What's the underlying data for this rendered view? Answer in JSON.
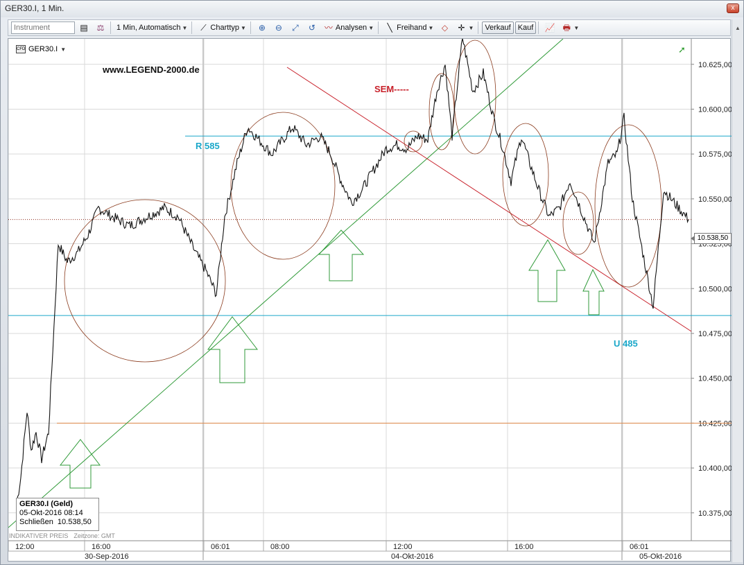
{
  "window": {
    "title": "GER30.I, 1 Min.",
    "close_label": "x"
  },
  "toolbar": {
    "instrument_placeholder": "Instrument",
    "interval_label": "1 Min,",
    "interval_mode": "Automatisch",
    "charttype_label": "Charttyp",
    "analysen_label": "Analysen",
    "freihand_label": "Freihand",
    "verkauf_label": "Verkauf",
    "kauf_label": "Kauf"
  },
  "chart_header": {
    "instrument": "GER30.I",
    "cfd_badge": "CFD"
  },
  "annotations": {
    "website": "www.LEGEND-2000.de",
    "sem": "SEM-----",
    "r585": "R 585",
    "u485": "U 485"
  },
  "tooltip": {
    "title": "GER30.I (Geld)",
    "datetime": "05-Okt-2016 08:14",
    "close_label": "Schließen",
    "close_value": "10.538,50"
  },
  "footer": {
    "indicative": "INDIKATIVER PREIS",
    "timezone": "Zeitzone: GMT"
  },
  "price_tag": "10.538,50",
  "colors": {
    "price_line": "#111111",
    "resistance": "#1aa7c9",
    "support_orange": "#e08a4a",
    "trend_green": "#2f9a38",
    "trend_red": "#c8202a",
    "circles": "#8a3a1c",
    "arrows": "#2f9a38"
  },
  "chart_data": {
    "type": "line",
    "title": "",
    "xlabel": "",
    "ylabel": "",
    "ylim": [
      10365,
      10650
    ],
    "y_ticks": [
      "10.375,00",
      "10.400,00",
      "10.425,00",
      "10.450,00",
      "10.475,00",
      "10.500,00",
      "10.525,00",
      "10.550,00",
      "10.575,00",
      "10.600,00",
      "10.625,00"
    ],
    "x_ticks": [
      "12:00",
      "16:00",
      "06:01",
      "08:00",
      "12:00",
      "16:00",
      "06:01"
    ],
    "date_labels": [
      "30-Sep-2016",
      "04-Okt-2016",
      "05-Okt-2016"
    ],
    "last_price": 10538.5,
    "horizontal_levels": [
      {
        "name": "R 585",
        "value": 10585
      },
      {
        "name": "U 485",
        "value": 10485
      },
      {
        "name": "",
        "value": 10425
      },
      {
        "name": "",
        "value": 10538.5
      }
    ],
    "series": [
      {
        "x": [
          "30-Sep 10:45",
          "30-Sep 11:00",
          "30-Sep 11:15",
          "30-Sep 11:30",
          "30-Sep 11:45",
          "30-Sep 12:00",
          "30-Sep 12:30",
          "30-Sep 13:00",
          "30-Sep 13:30",
          "30-Sep 14:00",
          "30-Sep 14:15",
          "30-Sep 14:30",
          "30-Sep 15:00",
          "30-Sep 15:30",
          "30-Sep 16:00",
          "30-Sep 16:30",
          "30-Sep 17:00",
          "30-Sep 18:00",
          "30-Sep 19:00",
          "30-Sep 20:00",
          "30-Sep 21:00",
          "30-Sep 21:30",
          "30-Sep 22:00",
          "04-Okt 05:00",
          "04-Okt 06:01",
          "04-Okt 06:30",
          "04-Okt 07:00",
          "04-Okt 07:30",
          "04-Okt 08:00",
          "04-Okt 08:30",
          "04-Okt 09:00",
          "04-Okt 09:30",
          "04-Okt 10:00",
          "04-Okt 10:30",
          "04-Okt 11:00",
          "04-Okt 11:30",
          "04-Okt 12:00",
          "04-Okt 12:30",
          "04-Okt 13:00",
          "04-Okt 13:30",
          "04-Okt 14:00",
          "04-Okt 14:30",
          "04-Okt 15:00",
          "04-Okt 15:30",
          "04-Okt 16:00",
          "04-Okt 16:30",
          "04-Okt 17:00",
          "04-Okt 17:30",
          "04-Okt 18:00",
          "04-Okt 18:30",
          "04-Okt 19:00",
          "04-Okt 19:30",
          "04-Okt 20:00",
          "04-Okt 20:30",
          "04-Okt 21:00",
          "04-Okt 21:30",
          "05-Okt 06:01",
          "05-Okt 06:30",
          "05-Okt 07:00",
          "05-Okt 07:30",
          "05-Okt 08:00",
          "05-Okt 08:14"
        ],
        "values": [
          10380,
          10395,
          10432,
          10410,
          10420,
          10405,
          10420,
          10525,
          10515,
          10520,
          10530,
          10545,
          10540,
          10535,
          10540,
          10545,
          10540,
          10520,
          10510,
          10497,
          10540,
          10570,
          10590,
          10575,
          10590,
          10580,
          10585,
          10575,
          10560,
          10548,
          10555,
          10565,
          10578,
          10580,
          10578,
          10585,
          10583,
          10610,
          10625,
          10585,
          10640,
          10610,
          10620,
          10595,
          10580,
          10560,
          10585,
          10570,
          10555,
          10540,
          10545,
          10560,
          10545,
          10525,
          10570,
          10575,
          10595,
          10550,
          10520,
          10490,
          10555,
          10538.5
        ]
      }
    ]
  }
}
